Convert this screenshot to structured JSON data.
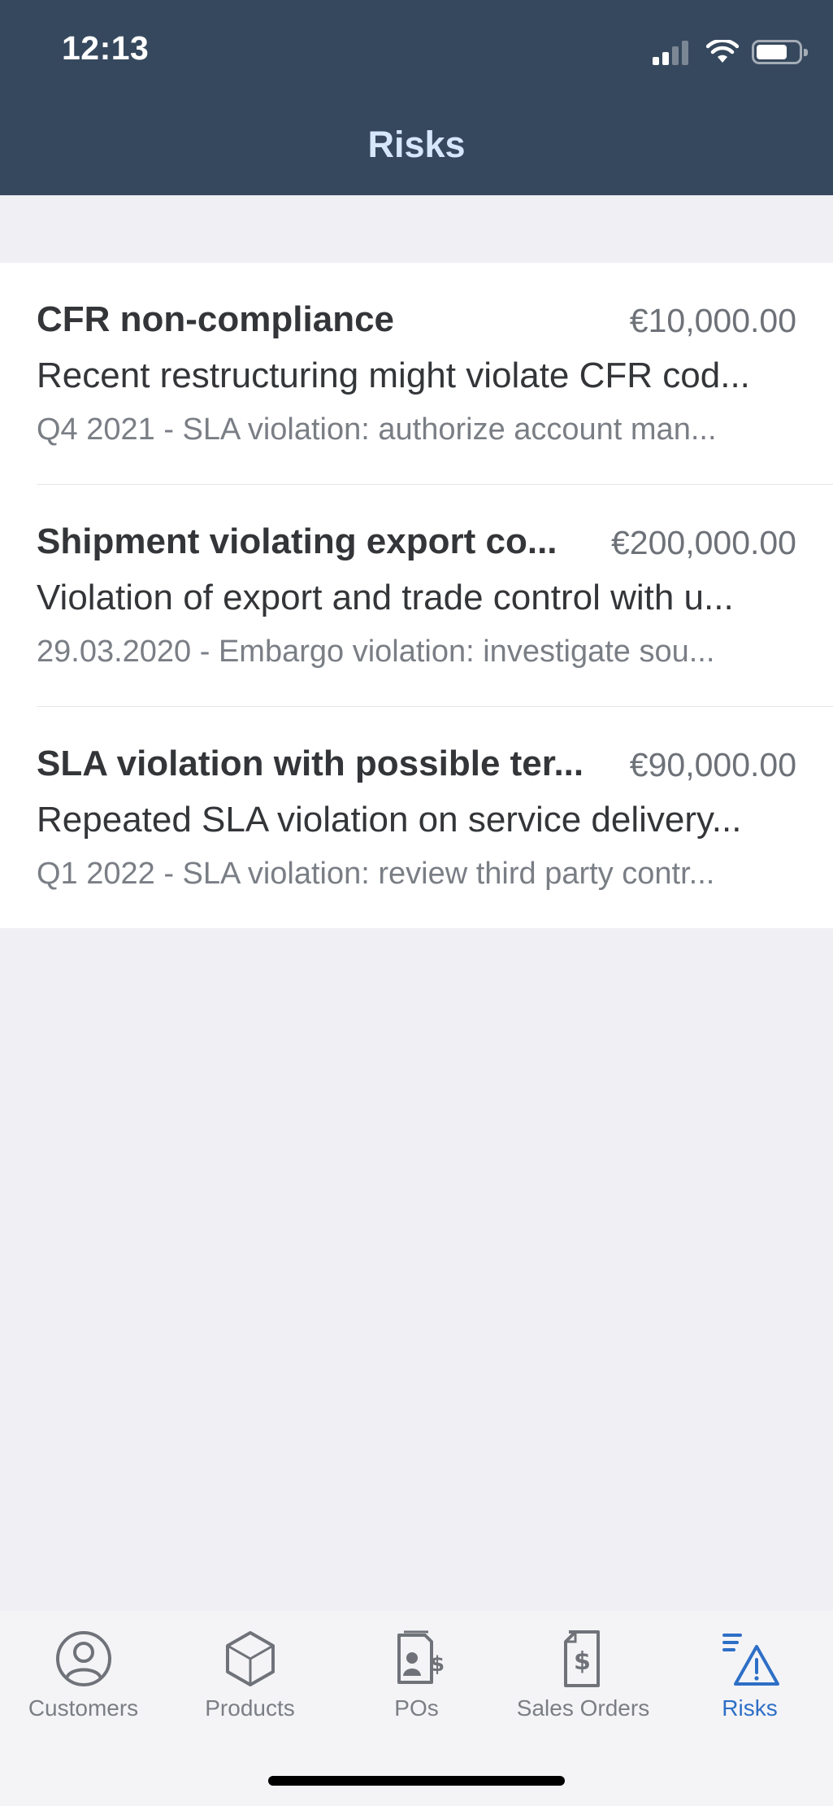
{
  "status_bar": {
    "time": "12:13"
  },
  "nav": {
    "title": "Risks"
  },
  "risks": [
    {
      "title": "CFR non-compliance",
      "amount": "€10,000.00",
      "description": "Recent restructuring might violate CFR cod...",
      "subtitle": "Q4 2021 - SLA violation: authorize account man..."
    },
    {
      "title": "Shipment violating export co...",
      "amount": "€200,000.00",
      "description": "Violation of export and trade control with u...",
      "subtitle": "29.03.2020 - Embargo violation: investigate sou..."
    },
    {
      "title": "SLA violation with possible ter...",
      "amount": "€90,000.00",
      "description": "Repeated SLA violation on service delivery...",
      "subtitle": "Q1 2022 - SLA violation: review third party contr..."
    }
  ],
  "tabs": [
    {
      "label": "Customers",
      "icon": "user-circle-icon",
      "active": false
    },
    {
      "label": "Products",
      "icon": "cube-icon",
      "active": false
    },
    {
      "label": "POs",
      "icon": "purchase-order-icon",
      "active": false
    },
    {
      "label": "Sales Orders",
      "icon": "sales-document-icon",
      "active": false
    },
    {
      "label": "Risks",
      "icon": "warning-triangle-icon",
      "active": true
    }
  ],
  "colors": {
    "header_bg": "#36485d",
    "header_title": "#d6e6fb",
    "active_tab": "#2e6fc6",
    "inactive_tab": "#7b7e84"
  }
}
